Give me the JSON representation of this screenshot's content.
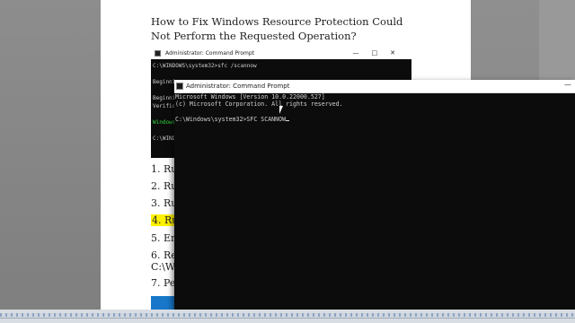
{
  "article": {
    "title": "How to Fix Windows Resource Protection Could Not Perform the Requested Operation?",
    "embedded_window": {
      "title": "Administrator: Command Prompt",
      "controls": "—□✕",
      "lines": [
        "C:\\WINDOWS\\system32>sfc /scannow",
        "",
        "Beginni",
        "",
        "Beginni",
        "Verific",
        "",
        "Windows",
        "",
        "C:\\WINDO"
      ]
    },
    "steps": [
      {
        "text": "1. Ru"
      },
      {
        "text": "2. Ru"
      },
      {
        "text": "3. Ru"
      },
      {
        "text": "4. Ru"
      },
      {
        "text": "5. Ena"
      },
      {
        "text": "6. Res"
      },
      {
        "text": "C:\\Wi"
      },
      {
        "text": "7. Per"
      }
    ]
  },
  "cmd": {
    "title": "Administrator: Command Prompt",
    "minimize": "—",
    "line1": "Microsoft Windows [Version 10.0.22000.527]",
    "line2": "(c) Microsoft Corporation. All rights reserved.",
    "prompt": "C:\\Windows\\system32>SFC SCANNOW"
  },
  "colors": {
    "highlight": "#fff200",
    "console_bg": "#0c0c0c",
    "console_text": "#cfcfcf",
    "green": "#2fd43a"
  }
}
